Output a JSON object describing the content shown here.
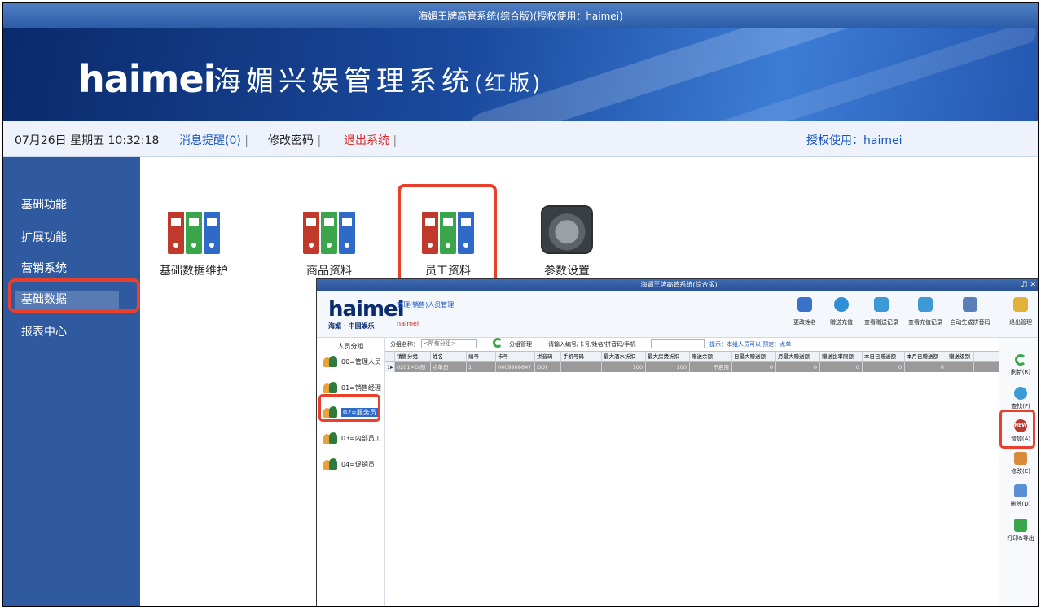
{
  "window": {
    "title": "海媚王牌高管系统(综合版)(授权使用：haimei)"
  },
  "banner": {
    "brand": "haimei",
    "system_name": "海媚兴娱管理系统",
    "edition": "(红版)"
  },
  "infobar": {
    "datetime": "07月26日 星期五 10:32:18",
    "messages": "消息提醒(0)",
    "sep": "|",
    "change_password": "修改密码",
    "logout": "退出系统",
    "license": "授权使用：haimei"
  },
  "sidebar": {
    "items": [
      {
        "label": "基础功能"
      },
      {
        "label": "扩展功能"
      },
      {
        "label": "营销系统"
      },
      {
        "label": "基础数据"
      },
      {
        "label": "报表中心"
      }
    ]
  },
  "tiles": [
    {
      "label": "基础数据维护",
      "icon": "binders-icon"
    },
    {
      "label": "商品资料",
      "icon": "binders-icon"
    },
    {
      "label": "员工资料",
      "icon": "binders-icon"
    },
    {
      "label": "参数设置",
      "icon": "gear-icon"
    }
  ],
  "inner": {
    "title": "海媚王牌高管系统(综合版)",
    "window_controls": "♬ ✕",
    "logo": "haimei",
    "logo_sub": "海媚 · 中国娱乐",
    "path": "管理(销售)人员管理",
    "user": "haimei",
    "toolbar": [
      {
        "label": "更改姓名",
        "color": "#3a72c9"
      },
      {
        "label": "赠送充值",
        "color": "#2e8fd6"
      },
      {
        "label": "查看赠送记录",
        "color": "#3c9ad6"
      },
      {
        "label": "查看充值记录",
        "color": "#3c9ad6"
      },
      {
        "label": "自动生成拼音码",
        "color": "#5a7fb8"
      },
      {
        "label": "退出管理",
        "color": "#e0b23a"
      }
    ],
    "group_header": "人员分组",
    "groups": [
      {
        "label": "00=管理人员"
      },
      {
        "label": "01=销售经理"
      },
      {
        "label": "02=服务员"
      },
      {
        "label": "03=内部员工"
      },
      {
        "label": "04=促销员"
      }
    ],
    "filter": {
      "group_label": "分组名称：",
      "group_value": "<所有分组>",
      "group_manage": "分组管理",
      "search_label": "请输入编号/卡号/姓名/拼音码/手机",
      "hint": "提示：本组人员可以 预定：点单"
    },
    "grid": {
      "columns": [
        "销售分组",
        "姓名",
        "编号",
        "卡号",
        "拼音码",
        "手机号码",
        "最大酒水折扣",
        "最大房费折扣",
        "赠送余额",
        "日最大赠送额",
        "月最大赠送额",
        "赠送比率限额",
        "本日已赠送额",
        "本月已赠送额",
        "赠送级别"
      ],
      "rows": [
        [
          "0201=DJ部",
          "点单员",
          "1",
          "0009908647",
          "DDY",
          "",
          "100",
          "100",
          "不启用",
          "0",
          "0",
          "0",
          "0",
          "0",
          ""
        ]
      ],
      "row_marker": "1▸"
    },
    "right_actions": [
      {
        "label": "刷新(R)",
        "color": "#3aa54a"
      },
      {
        "label": "查找(F)",
        "color": "#3c9ad6"
      },
      {
        "label": "增加(A)",
        "color": "#c0392b",
        "badge": "NEW"
      },
      {
        "label": "修改(E)",
        "color": "#d98a3a"
      },
      {
        "label": "删除(D)",
        "color": "#5a8fd6"
      },
      {
        "label": "打印&导出",
        "color": "#3aa54a"
      }
    ]
  }
}
